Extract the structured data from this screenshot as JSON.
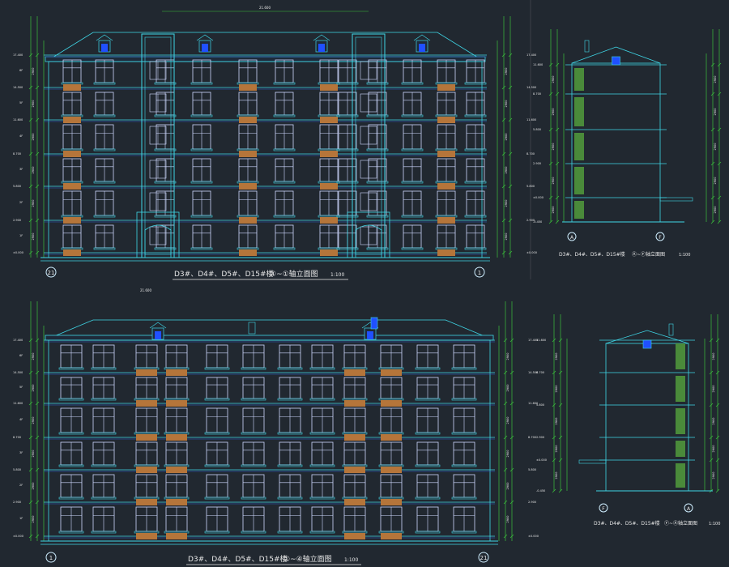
{
  "drawing": {
    "background": "#212830",
    "colors": {
      "outline": "#3fd6e6",
      "wall": "#2f5fd0",
      "window": "#cfd9ff",
      "dim": "#3bbf3b",
      "level_mark": "#cfeeff",
      "slab": "#4a8a3a",
      "text": "#e8e8e8",
      "accent": "#b5753a",
      "blue": "#2050ff"
    }
  },
  "elevations": [
    {
      "id": "front-top",
      "title": "D3#、D4#、D5#、D15#楼",
      "suffix": "④~①轴立面图",
      "scale": "1:100",
      "axis_left": "21",
      "axis_right": "1",
      "heights": [
        "21.600",
        "21.000",
        "20.100",
        "17.400",
        "14.500",
        "11.600",
        "8.700",
        "5.800",
        "2.900",
        "±0.000",
        "-0.450",
        "-0.600"
      ],
      "floors": [
        "6F",
        "5F",
        "4F",
        "3F",
        "2F",
        "1F"
      ]
    },
    {
      "id": "side-top",
      "title": "D3#、D4#、D5#、D15#楼",
      "suffix": "Ⓐ~Ⓕ轴立面图",
      "scale": "1:100",
      "axis_left": "A",
      "axis_right": "F",
      "heights": [
        "21.600",
        "17.400",
        "14.500",
        "11.600",
        "8.700",
        "5.800",
        "2.900",
        "±0.000",
        "-0.450"
      ]
    },
    {
      "id": "front-bottom",
      "title": "D3#、D4#、D5#、D15#楼",
      "suffix": "①~④轴立面图",
      "scale": "1:100",
      "axis_left": "1",
      "axis_right": "21",
      "heights": [
        "21.600",
        "20.100",
        "18.300",
        "17.400",
        "14.500",
        "11.600",
        "8.700",
        "5.800",
        "2.900",
        "±0.000",
        "-0.450"
      ],
      "floors": [
        "6F",
        "5F",
        "4F",
        "3F",
        "2F",
        "1F"
      ]
    },
    {
      "id": "side-bottom",
      "title": "D3#、D4#、D5#、D15#楼",
      "suffix": "Ⓕ~Ⓐ轴立面图",
      "scale": "1:100",
      "axis_left": "F",
      "axis_right": "A",
      "heights": [
        "21.600",
        "17.400",
        "14.500",
        "11.600",
        "8.700",
        "5.800",
        "2.900",
        "±0.000",
        "-0.450"
      ]
    }
  ]
}
